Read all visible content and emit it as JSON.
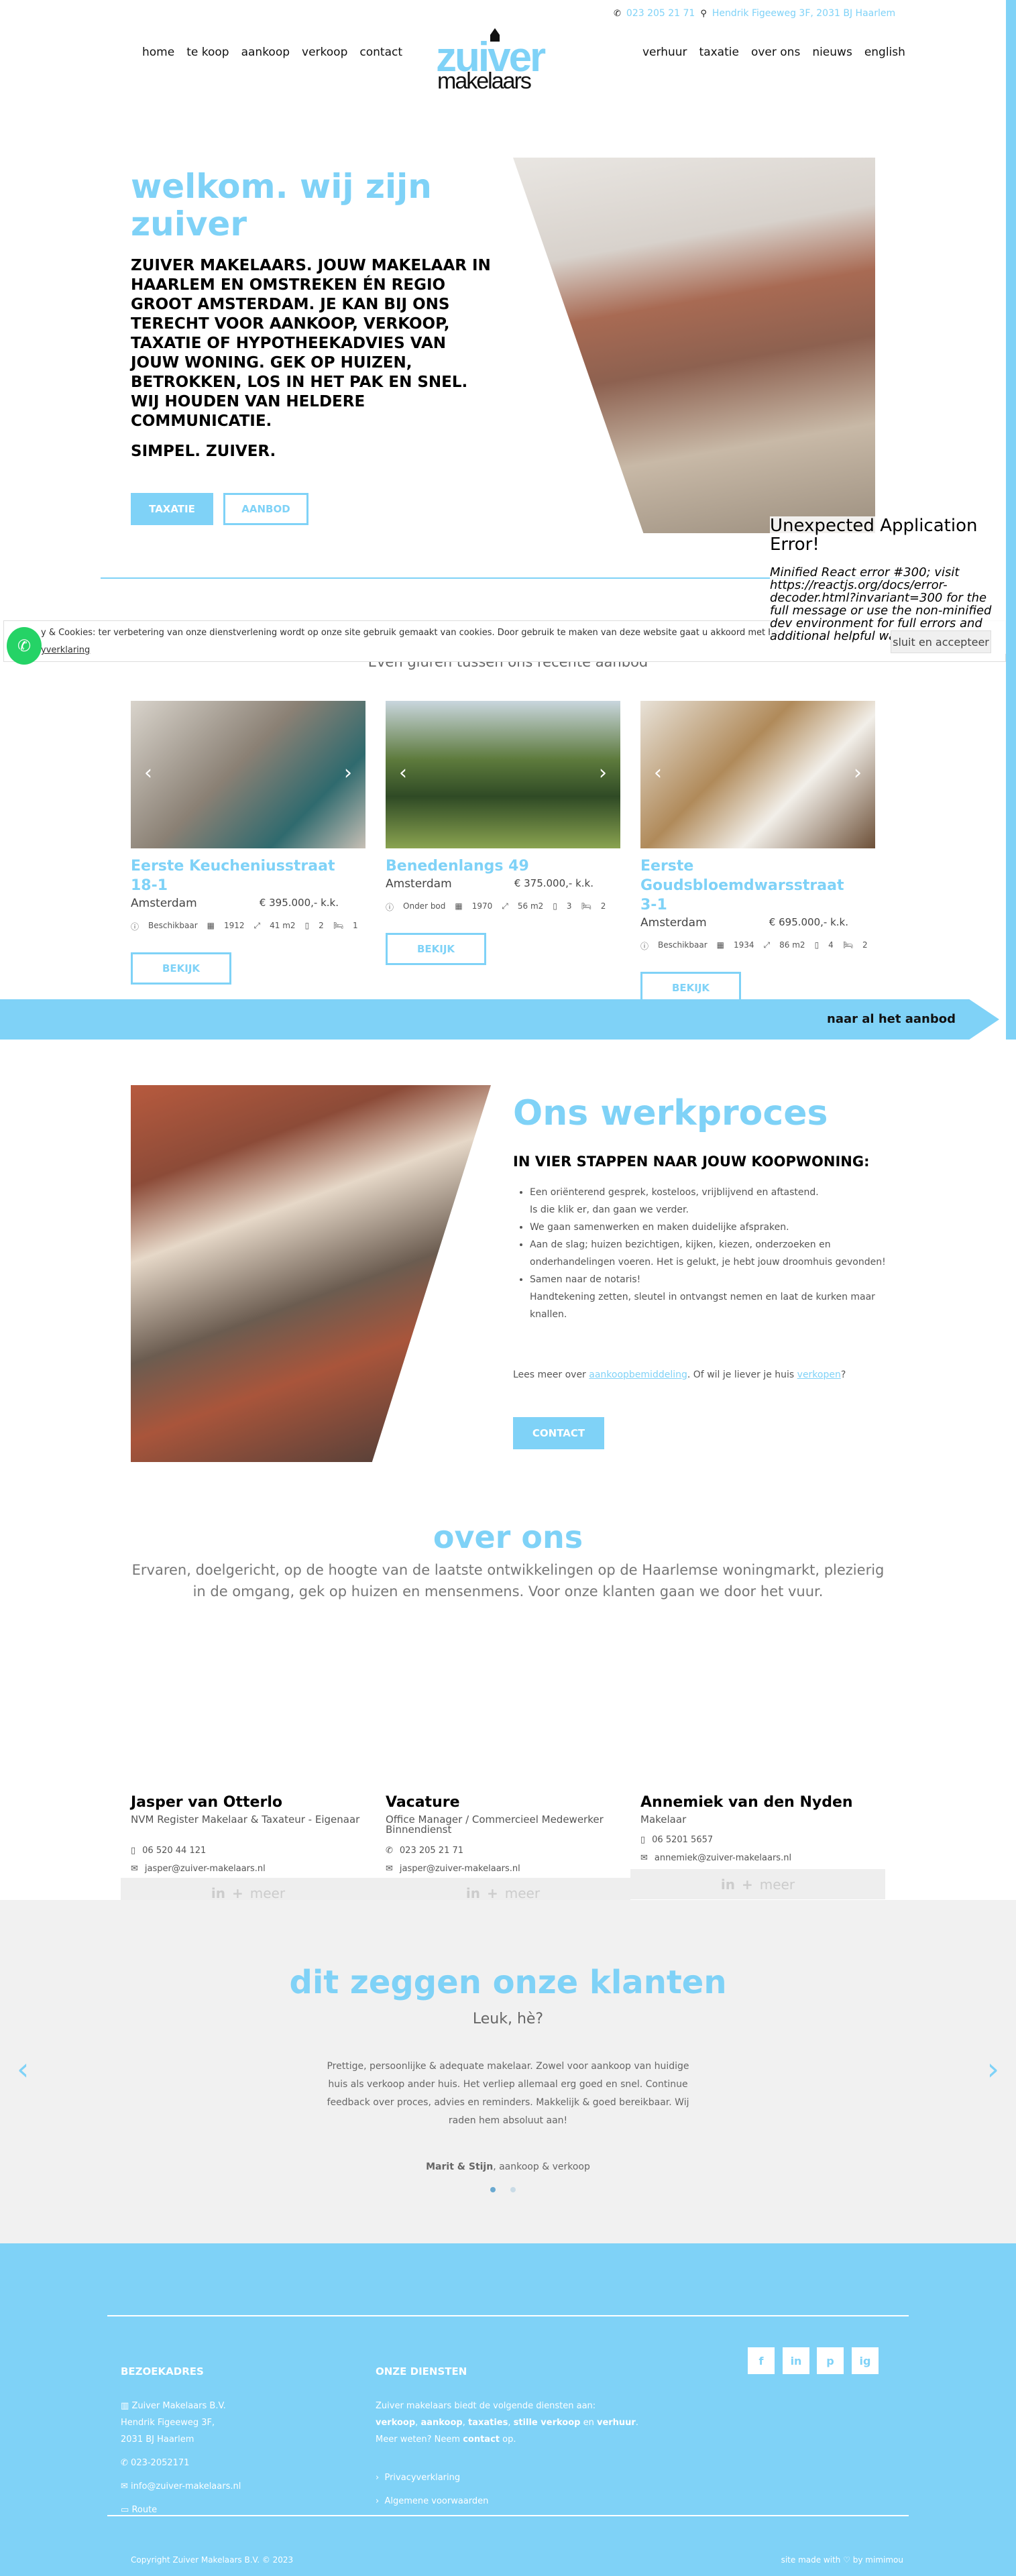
{
  "colors": {
    "accent": "#7fd2f7",
    "whatsapp": "#25d366",
    "testimonial_bg": "#f1f1f1"
  },
  "topbar": {
    "phone": "023 205 21 71",
    "address": "Hendrik Figeeweg 3F, 2031 BJ Haarlem",
    "phone_icon": "phone-icon",
    "address_icon": "map-pin-icon"
  },
  "nav": {
    "left": [
      "home",
      "te koop",
      "aankoop",
      "verkoop",
      "contact"
    ],
    "right": [
      "verhuur",
      "taxatie",
      "over ons",
      "nieuws",
      "english"
    ]
  },
  "logo": {
    "word1": "zuiver",
    "word2": "makelaars"
  },
  "hero": {
    "title": "welkom. wij zijn zuiver",
    "text": "Zuiver makelaars. Jouw makelaar in Haarlem en omstreken én regio Groot Amsterdam. Je kan bij ons terecht voor aankoop, verkoop, taxatie of hypotheekadvies van jouw woning. Gek op huizen, betrokken, los in het pak en snel. Wij houden van heldere communicatie.",
    "slogan": "SIMPEL. ZUIVER.",
    "btn_taxatie": "TAXATIE",
    "btn_aanbod": "AANBOD"
  },
  "cookie": {
    "text": "y & Cookies: ter verbetering van onze dienstverlening wordt op onze site gebruik gemaakt van cookies. Door gebruik te maken van deze website gaat u akkoord met het gebruik van cookies.",
    "link": "yverklaring",
    "accept": "sluit en accepteer"
  },
  "error": {
    "title": "Unexpected Application Error!",
    "message": "Minified React error #300; visit https://reactjs.org/docs/error-decoder.html?invariant=300 for the full message or use the non-minified dev environment for full errors and additional helpful warnings."
  },
  "aanbod": {
    "subtitle": "Even gluren tussen ons recente aanbod",
    "more": "naar al het aanbod",
    "button": "BEKIJK",
    "listings": [
      {
        "title": "Eerste Keucheniusstraat 18-1",
        "city": "Amsterdam",
        "price": "€ 395.000,- k.k.",
        "status": "Beschikbaar",
        "year": "1912",
        "area": "41 m2",
        "rooms": "2",
        "bedrooms": "1"
      },
      {
        "title": "Benedenlangs 49",
        "city": "Amsterdam",
        "price": "€ 375.000,- k.k.",
        "status": "Onder bod",
        "year": "1970",
        "area": "56 m2",
        "rooms": "3",
        "bedrooms": "2"
      },
      {
        "title": "Eerste Goudsbloemdwarsstraat 3-1",
        "city": "Amsterdam",
        "price": "€ 695.000,- k.k.",
        "status": "Beschikbaar",
        "year": "1934",
        "area": "86 m2",
        "rooms": "4",
        "bedrooms": "2"
      }
    ]
  },
  "werkproces": {
    "title": "Ons werkproces",
    "subtitle": "IN VIER STAPPEN NAAR JOUW KOOPWONING:",
    "steps": [
      "Een oriënterend gesprek, kosteloos, vrijblijvend en aftastend.",
      "Is die klik er, dan gaan we verder.",
      "We gaan samenwerken en maken duidelijke afspraken.",
      "Aan de slag; huizen bezichtigen, kijken, kiezen, onderzoeken en onderhandelingen voeren. Het is gelukt, je hebt jouw droomhuis gevonden!",
      "Samen naar de notaris!",
      "Handtekening zetten, sleutel in ontvangst nemen en laat de kurken maar knallen."
    ],
    "more_prefix": "Lees meer over ",
    "more_link1": "aankoopbemiddeling",
    "more_mid": ". Of wil je liever je huis ",
    "more_link2": "verkopen",
    "more_suffix": "?",
    "contact": "CONTACT"
  },
  "overons": {
    "title": "over ons",
    "text": "Ervaren, doelgericht, op de hoogte van de laatste ontwikkelingen op de Haarlemse woningmarkt, plezierig in de omgang, gek op huizen en mensenmens. Voor onze klanten gaan we door het vuur."
  },
  "team": [
    {
      "name": "Jasper van Otterlo",
      "role": "NVM Register Makelaar & Taxateur - Eigenaar",
      "phone": "06 520 44 121",
      "email": "jasper@zuiver-makelaars.nl"
    },
    {
      "name": "Vacature",
      "role": "Office Manager / Commercieel Medewerker Binnendienst",
      "phone": "023 205 21 71",
      "email": "jasper@zuiver-makelaars.nl"
    },
    {
      "name": "Annemiek van den Nyden",
      "role": "Makelaar",
      "phone": "06 5201 5657",
      "email": "annemiek@zuiver-makelaars.nl"
    }
  ],
  "team_bar": {
    "linkedin": "in",
    "more": "meer"
  },
  "testimonials": {
    "title": "dit zeggen onze klanten",
    "subtitle": "Leuk, hè?",
    "quote": "Prettige, persoonlijke & adequate makelaar. Zowel voor aankoop van huidige huis als verkoop ander huis. Het verliep allemaal erg goed en snel. Continue feedback over proces, advies en reminders. Makkelijk & goed bereikbaar. Wij raden hem absoluut aan!",
    "author": "Marit & Stijn",
    "author_suffix": ", aankoop & verkoop",
    "active_slide": 1,
    "slides": 2
  },
  "footer": {
    "h1": "BEZOEKADRES",
    "company": "Zuiver Makelaars B.V.",
    "street": "Hendrik Figeeweg 3F,",
    "zip": "2031 BJ Haarlem",
    "phone": "023-2052171",
    "email": "info@zuiver-makelaars.nl",
    "route": "Route",
    "h2": "ONZE DIENSTEN",
    "services_intro": "Zuiver makelaars biedt de volgende diensten aan:",
    "s1": "verkoop",
    "s2": "aankoop",
    "s3": "taxaties",
    "s4": "stille verkoop",
    "s_en": " en ",
    "s5": "verhuur",
    "more_prefix": "Meer weten? Neem ",
    "more_link": "contact",
    "more_suffix": " op.",
    "privacy": "Privacyverklaring",
    "terms": "Algemene voorwaarden",
    "copyright": "Copyright Zuiver Makelaars B.V. © 2023",
    "madewith": "site made with ♡ by mimimou",
    "social": [
      "f",
      "in",
      "p",
      "ig"
    ]
  }
}
